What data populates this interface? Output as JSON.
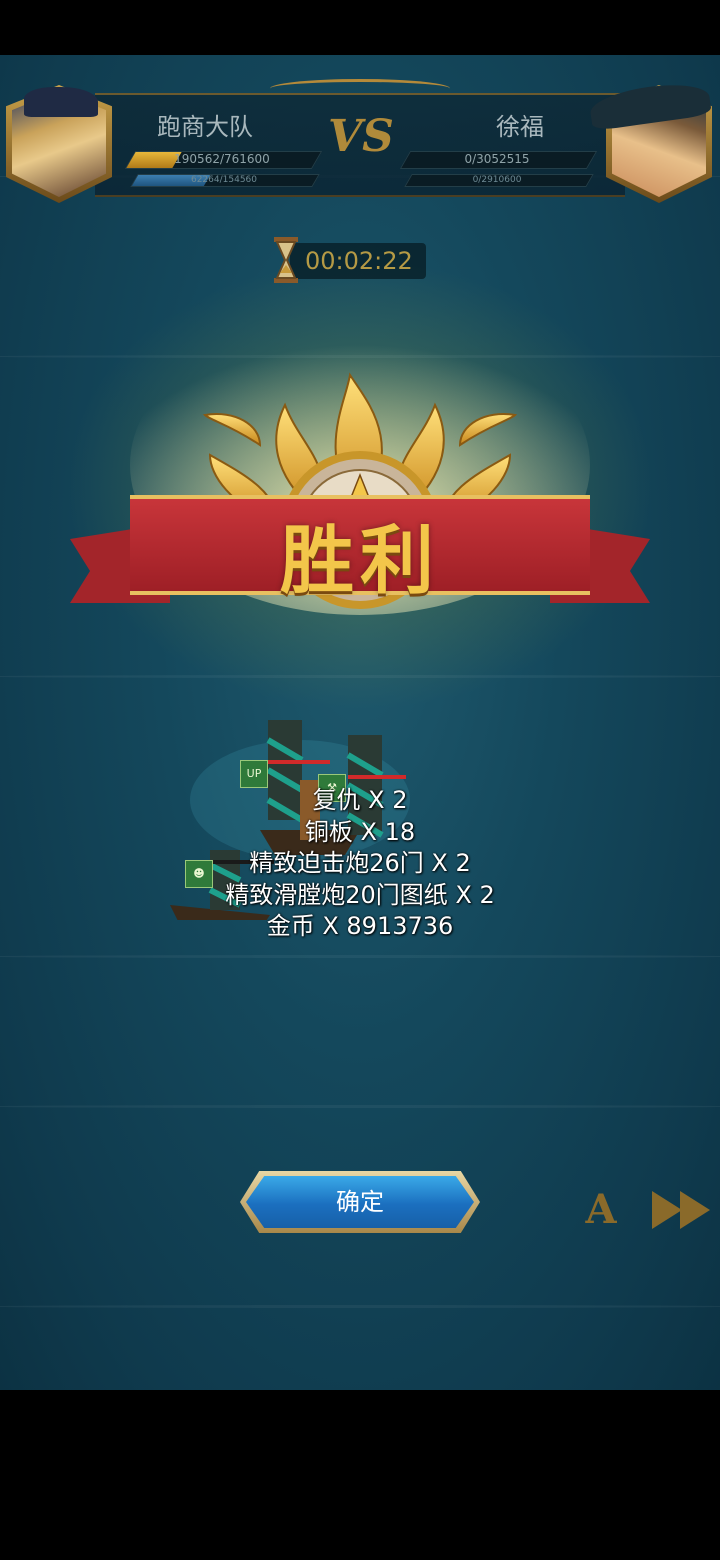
{
  "hud": {
    "player": {
      "name": "跑商大队",
      "hp_text": "190562/761600",
      "hp_fraction": 0.25,
      "sub_text": "62264/154560",
      "sub_fraction": 0.4
    },
    "vs_label": "VS",
    "enemy": {
      "name": "徐福",
      "hp_text": "0/3052515",
      "hp_fraction": 0.0,
      "sub_text": "0/2910600",
      "sub_fraction": 0.0
    },
    "timer": "00:02:22"
  },
  "result": {
    "title": "胜利"
  },
  "rewards": [
    "复仇 X 2",
    "铜板 X 18",
    "精致迫击炮26门 X 2",
    "精致滑膛炮20门图纸 X 2",
    "金币 X 8913736"
  ],
  "ship_status": {
    "up_badge": "UP"
  },
  "buttons": {
    "confirm": "确定",
    "auto": "A"
  },
  "colors": {
    "ocean": "#14485c",
    "gold": "#f3c64a",
    "ribbon": "#c8353a",
    "button_blue": "#2a8fd8"
  },
  "icons": {
    "player_avatar": "captain-portrait",
    "enemy_avatar": "pirate-portrait",
    "timer_icon": "hourglass-icon",
    "speed_icon": "fast-forward-icon"
  }
}
